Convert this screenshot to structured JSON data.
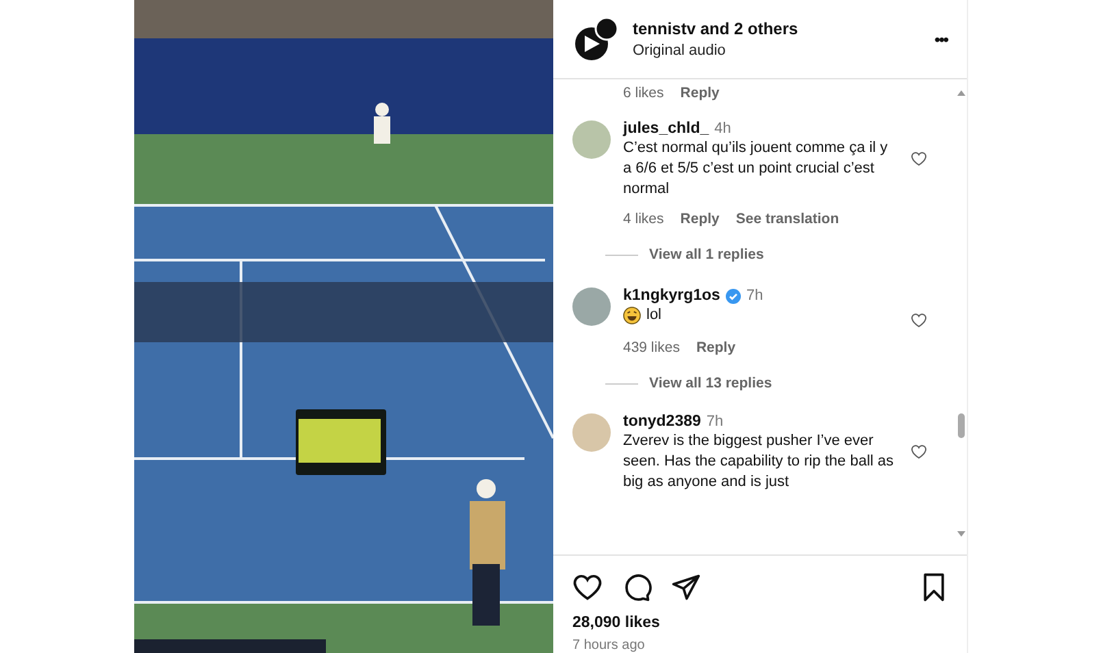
{
  "post": {
    "author": "tennistv and 2 others",
    "audio": "Original audio",
    "menu": "•••"
  },
  "comments": [
    {
      "likes": "6 likes",
      "reply": "Reply"
    },
    {
      "user": "jules_chld_",
      "time": "4h",
      "text": "C’est normal qu’ils jouent comme ça il y a 6/6 et 5/5 c’est un point crucial c’est normal",
      "likes": "4 likes",
      "reply": "Reply",
      "translation": "See translation",
      "replies": "View all 1 replies"
    },
    {
      "user": "k1ngkyrg1os",
      "time": "7h",
      "verified": true,
      "has_emoji": true,
      "text": "lol",
      "likes": "439 likes",
      "reply": "Reply",
      "replies": "View all 13 replies"
    },
    {
      "user": "tonyd2389",
      "time": "7h",
      "text": "Zverev is the biggest pusher I’ve ever seen. Has the capability to rip the ball as big as anyone and is just"
    }
  ],
  "footer": {
    "likes": "28,090 likes",
    "posted": "7 hours ago"
  }
}
